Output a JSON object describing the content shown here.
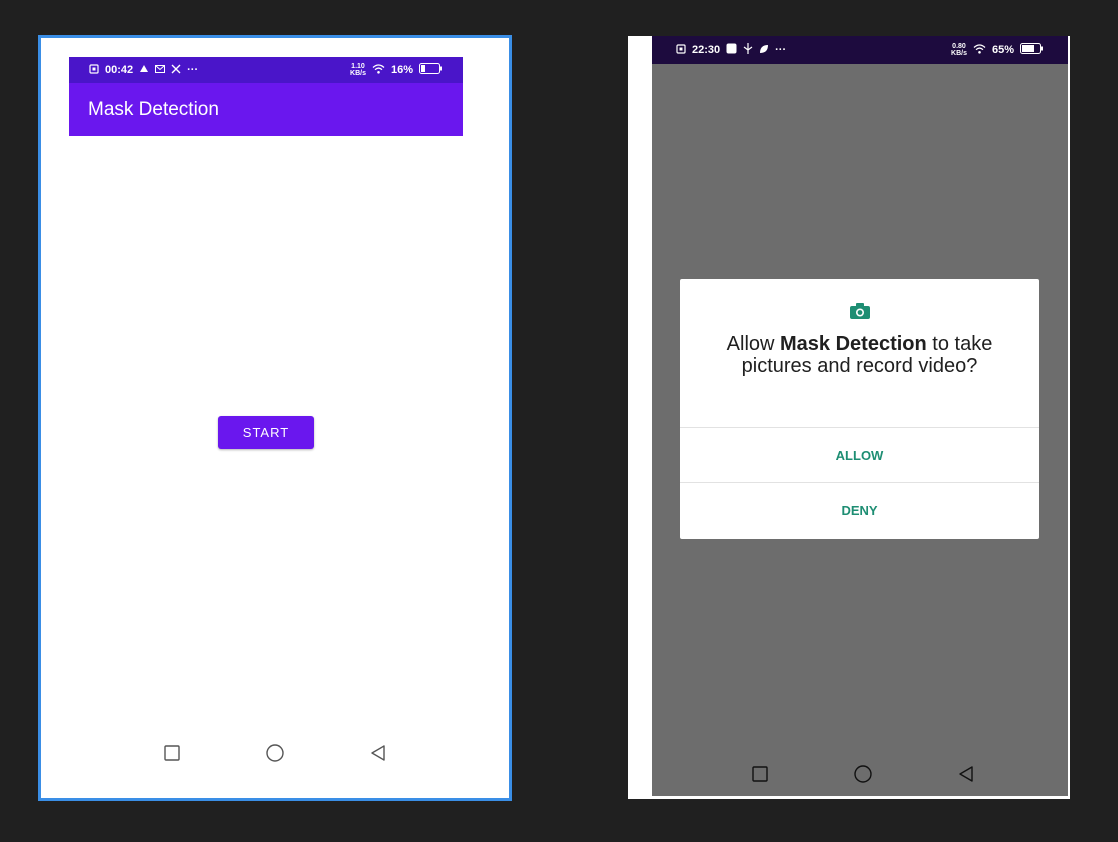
{
  "left_phone": {
    "status_bar": {
      "time": "00:42",
      "icons_left": [
        "sim-icon",
        "cloud-icon",
        "mail-icon",
        "tools-icon",
        "more-dots"
      ],
      "net_speed": "1.10",
      "net_speed_unit": "KB/s",
      "battery": "16%"
    },
    "app_title": "Mask Detection",
    "start_label": "START",
    "accent_color": "#6a17ee"
  },
  "right_phone": {
    "status_bar": {
      "time": "22:30",
      "net_speed": "0.80",
      "net_speed_unit": "KB/s",
      "battery": "65%"
    },
    "dialog": {
      "msg_prefix": "Allow ",
      "msg_app": "Mask Detection",
      "msg_suffix": " to take pictures and record video?",
      "allow_label": "ALLOW",
      "deny_label": "DENY",
      "button_color": "#1e8e73"
    }
  }
}
